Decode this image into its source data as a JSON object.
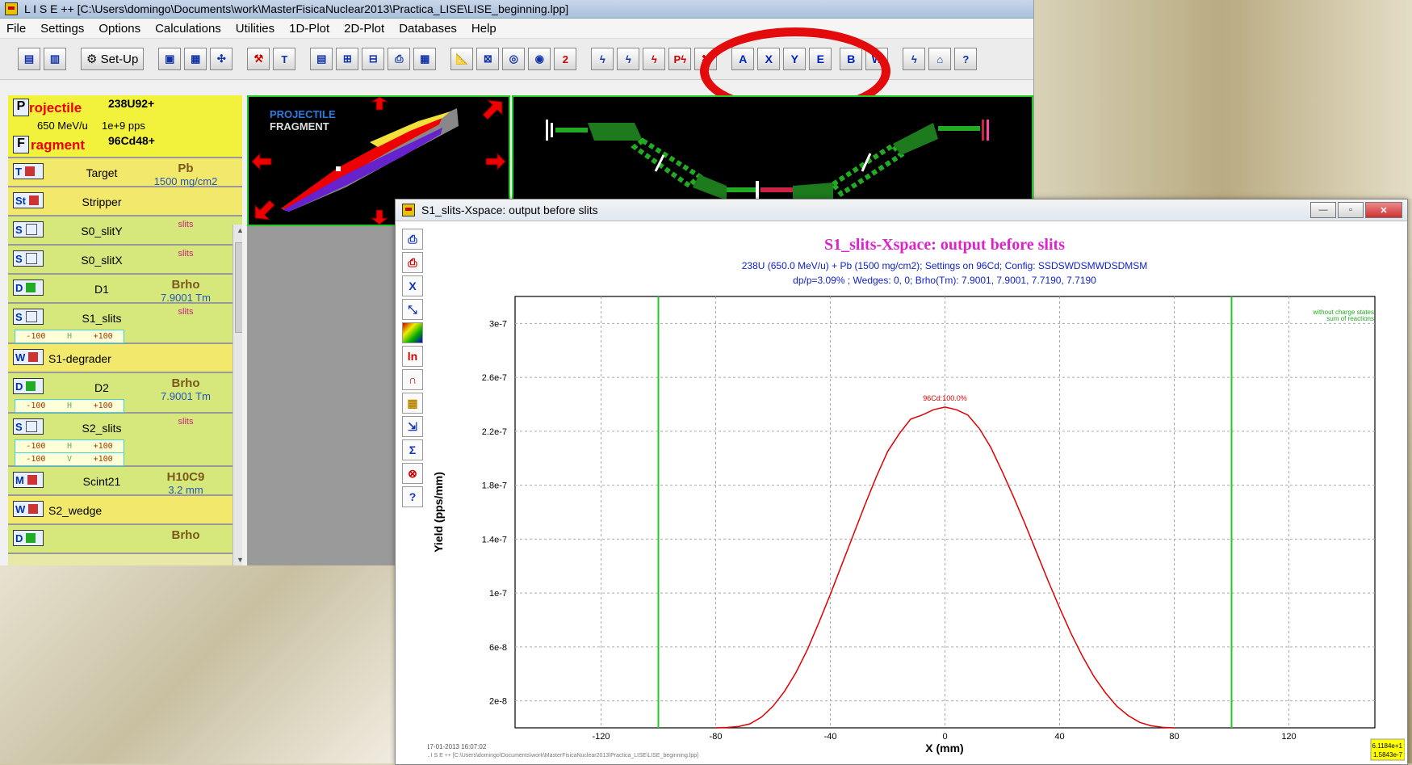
{
  "main_window": {
    "title": "L I S E ++  [C:\\Users\\domingo\\Documents\\work\\MasterFisicaNuclear2013\\Practica_LISE\\LISE_beginning.lpp]"
  },
  "menu": [
    {
      "label": "File"
    },
    {
      "label": "Settings"
    },
    {
      "label": "Options"
    },
    {
      "label": "Calculations"
    },
    {
      "label": "Utilities"
    },
    {
      "label": "1D-Plot"
    },
    {
      "label": "2D-Plot"
    },
    {
      "label": "Databases"
    },
    {
      "label": "Help"
    }
  ],
  "toolbar": {
    "setup_label": "Set-Up",
    "plot_buttons": [
      "A",
      "X",
      "Y",
      "E",
      "B",
      "W"
    ],
    "help_label": "?"
  },
  "projectile": {
    "projectile_label": "rojectile",
    "projectile_letter": "P",
    "beam": "238U92+",
    "beam_energy": "650 MeV/u",
    "beam_intensity": "1e+9 pps",
    "fragment_letter": "F",
    "fragment_label": "ragment",
    "fragment": "96Cd48+"
  },
  "blocks": [
    {
      "icon": "T",
      "name": "Target",
      "value": "Pb",
      "sub": "1500 mg/cm2",
      "style": "yel"
    },
    {
      "icon": "St",
      "name": "Stripper",
      "value": "",
      "sub": "",
      "style": "yel"
    },
    {
      "icon": "S",
      "name": "S0_slitY",
      "value": "slits",
      "sub": "",
      "style": "grn"
    },
    {
      "icon": "S",
      "name": "S0_slitX",
      "value": "slits",
      "sub": "",
      "style": "grn"
    },
    {
      "icon": "D",
      "name": "D1",
      "value": "Brho",
      "sub": "7.9001 Tm",
      "style": "grn"
    },
    {
      "icon": "S",
      "name": "S1_slits",
      "value": "slits",
      "sub": "",
      "style": "grn",
      "range1": [
        "-100",
        "H",
        "+100"
      ]
    },
    {
      "icon": "W",
      "name": "S1-degrader",
      "value": "",
      "sub": "",
      "style": "yel"
    },
    {
      "icon": "D",
      "name": "D2",
      "value": "Brho",
      "sub": "7.9001 Tm",
      "style": "grn",
      "range1": [
        "-100",
        "H",
        "+100"
      ]
    },
    {
      "icon": "S",
      "name": "S2_slits",
      "value": "slits",
      "sub": "",
      "style": "grn",
      "range1": [
        "-100",
        "H",
        "+100"
      ],
      "range2": [
        "-100",
        "V",
        "+100"
      ]
    },
    {
      "icon": "M",
      "name": "Scint21",
      "value": "H10C9",
      "sub": "3.2 mm",
      "style": "grn"
    },
    {
      "icon": "W",
      "name": "S2_wedge",
      "value": "",
      "sub": "",
      "style": "yel"
    },
    {
      "icon": "D",
      "name": "",
      "value": "Brho",
      "sub": "",
      "style": "grn"
    }
  ],
  "pf_panel": {
    "line1": "PROJECTILE",
    "line2": "FRAGMENT"
  },
  "plot_window": {
    "title": "S1_slits-Xspace:  output before slits",
    "controls": [
      "—",
      "▫",
      "✕"
    ]
  },
  "colors": {
    "curve": "#e00000",
    "title": "#dd22cc",
    "subtitle": "#1122cc",
    "slit_lines": "#22cc22",
    "highlight": "#e30b0b"
  },
  "chart_data": {
    "type": "line",
    "title": "S1_slits-Xspace:  output before slits",
    "subtitle_line1": "238U (650.0 MeV/u) + Pb (1500 mg/cm2);  Settings on 96Cd;  Config: SSDSWDSMWDSDMSM",
    "subtitle_line2": "dp/p=3.09% ; Wedges: 0, 0; Brho(Tm): 7.9001, 7.9001, 7.7190, 7.7190",
    "xlabel": "X (mm)",
    "ylabel": "Yield (pps/mm)",
    "xlim": [
      -150,
      150
    ],
    "ylim": [
      0,
      3.2e-07
    ],
    "xticks": [
      -120,
      -80,
      -40,
      0,
      40,
      80,
      120
    ],
    "yticks": [
      2e-08,
      6e-08,
      1e-07,
      1.4e-07,
      1.8e-07,
      2.2e-07,
      2.6e-07,
      3e-07
    ],
    "ytick_labels": [
      "2e-8",
      "6e-8",
      "1e-7",
      "1.4e-7",
      "1.8e-7",
      "2.2e-7",
      "2.6e-7",
      "3e-7"
    ],
    "grid": true,
    "peak_label": "96Cd:100.0%",
    "legend_note1": "without charge states",
    "legend_note2": "sum of reactions",
    "slit_positions": [
      -100,
      100
    ],
    "series": [
      {
        "x": [
          -80,
          -76,
          -72,
          -68,
          -64,
          -60,
          -56,
          -52,
          -48,
          -44,
          -40,
          -36,
          -32,
          -28,
          -24,
          -20,
          -16,
          -12,
          -8,
          -4,
          0,
          4,
          8,
          12,
          16,
          20,
          24,
          28,
          32,
          36,
          40,
          44,
          48,
          52,
          56,
          60,
          64,
          68,
          72,
          76,
          80
        ],
        "values": [
          0,
          3e-10,
          1e-09,
          3e-09,
          8e-09,
          1.6e-08,
          2.7e-08,
          4.1e-08,
          5.8e-08,
          7.8e-08,
          9.9e-08,
          1.21e-07,
          1.43e-07,
          1.65e-07,
          1.86e-07,
          2.05e-07,
          2.18e-07,
          2.29e-07,
          2.32e-07,
          2.36e-07,
          2.38e-07,
          2.36e-07,
          2.32e-07,
          2.22e-07,
          2.08e-07,
          1.9e-07,
          1.71e-07,
          1.51e-07,
          1.3e-07,
          1.09e-07,
          8.9e-08,
          7e-08,
          5.3e-08,
          3.8e-08,
          2.6e-08,
          1.6e-08,
          9e-09,
          4e-09,
          1.5e-09,
          4e-10,
          0
        ]
      }
    ]
  },
  "footer": {
    "date": "17-01-2013  16:07:02",
    "path": "L I S E ++   [C:\\Users\\domingo\\Documents\\work\\MasterFisicaNuclear2013\\Practica_LISE\\LISE_beginning.lpp]",
    "value1": "6.1184e+1",
    "value2": "1.5843e-7"
  }
}
